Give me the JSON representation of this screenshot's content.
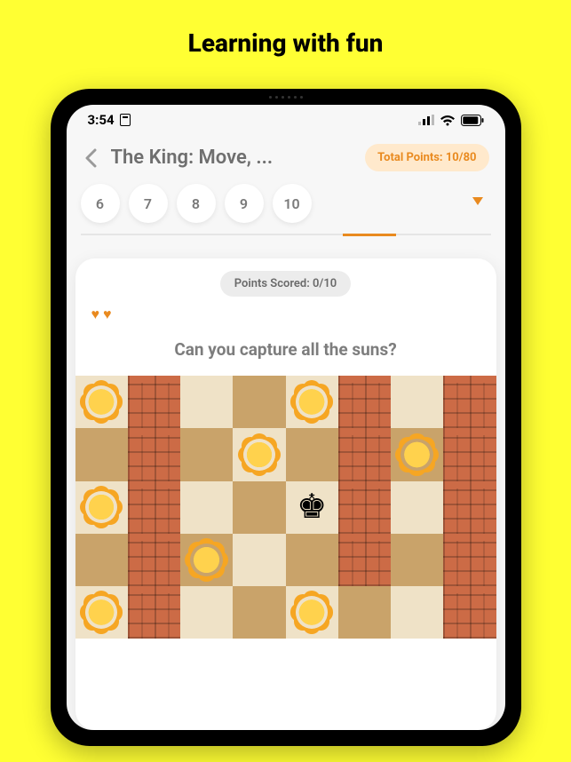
{
  "headline": "Learning with fun",
  "status": {
    "time": "3:54"
  },
  "header": {
    "lesson_title": "The King: Move, ...",
    "points_pill": "Total Points: 10/80"
  },
  "stepper": {
    "items": [
      "6",
      "7",
      "8",
      "9",
      "10"
    ],
    "active_index": 3,
    "progress_left_pct": 64,
    "progress_width_pct": 13
  },
  "card": {
    "scored_pill": "Points Scored: 0/10",
    "hearts_count": 2,
    "question": "Can you capture all the suns?"
  },
  "board": {
    "cols": 8,
    "rows": 5,
    "layout": [
      [
        "sun",
        "wall",
        "",
        "",
        "sun",
        "wall",
        "",
        "wall"
      ],
      [
        "",
        "wall",
        "",
        "sun",
        "",
        "wall",
        "sun",
        "wall"
      ],
      [
        "sun",
        "wall",
        "",
        "",
        "king",
        "wall",
        "",
        "wall"
      ],
      [
        "",
        "wall",
        "sun",
        "",
        "",
        "wall",
        "",
        "wall"
      ],
      [
        "sun",
        "wall",
        "",
        "",
        "sun",
        "",
        "",
        "wall"
      ]
    ]
  },
  "icons": {
    "king_glyph": "♚",
    "heart_glyph": "♥"
  }
}
